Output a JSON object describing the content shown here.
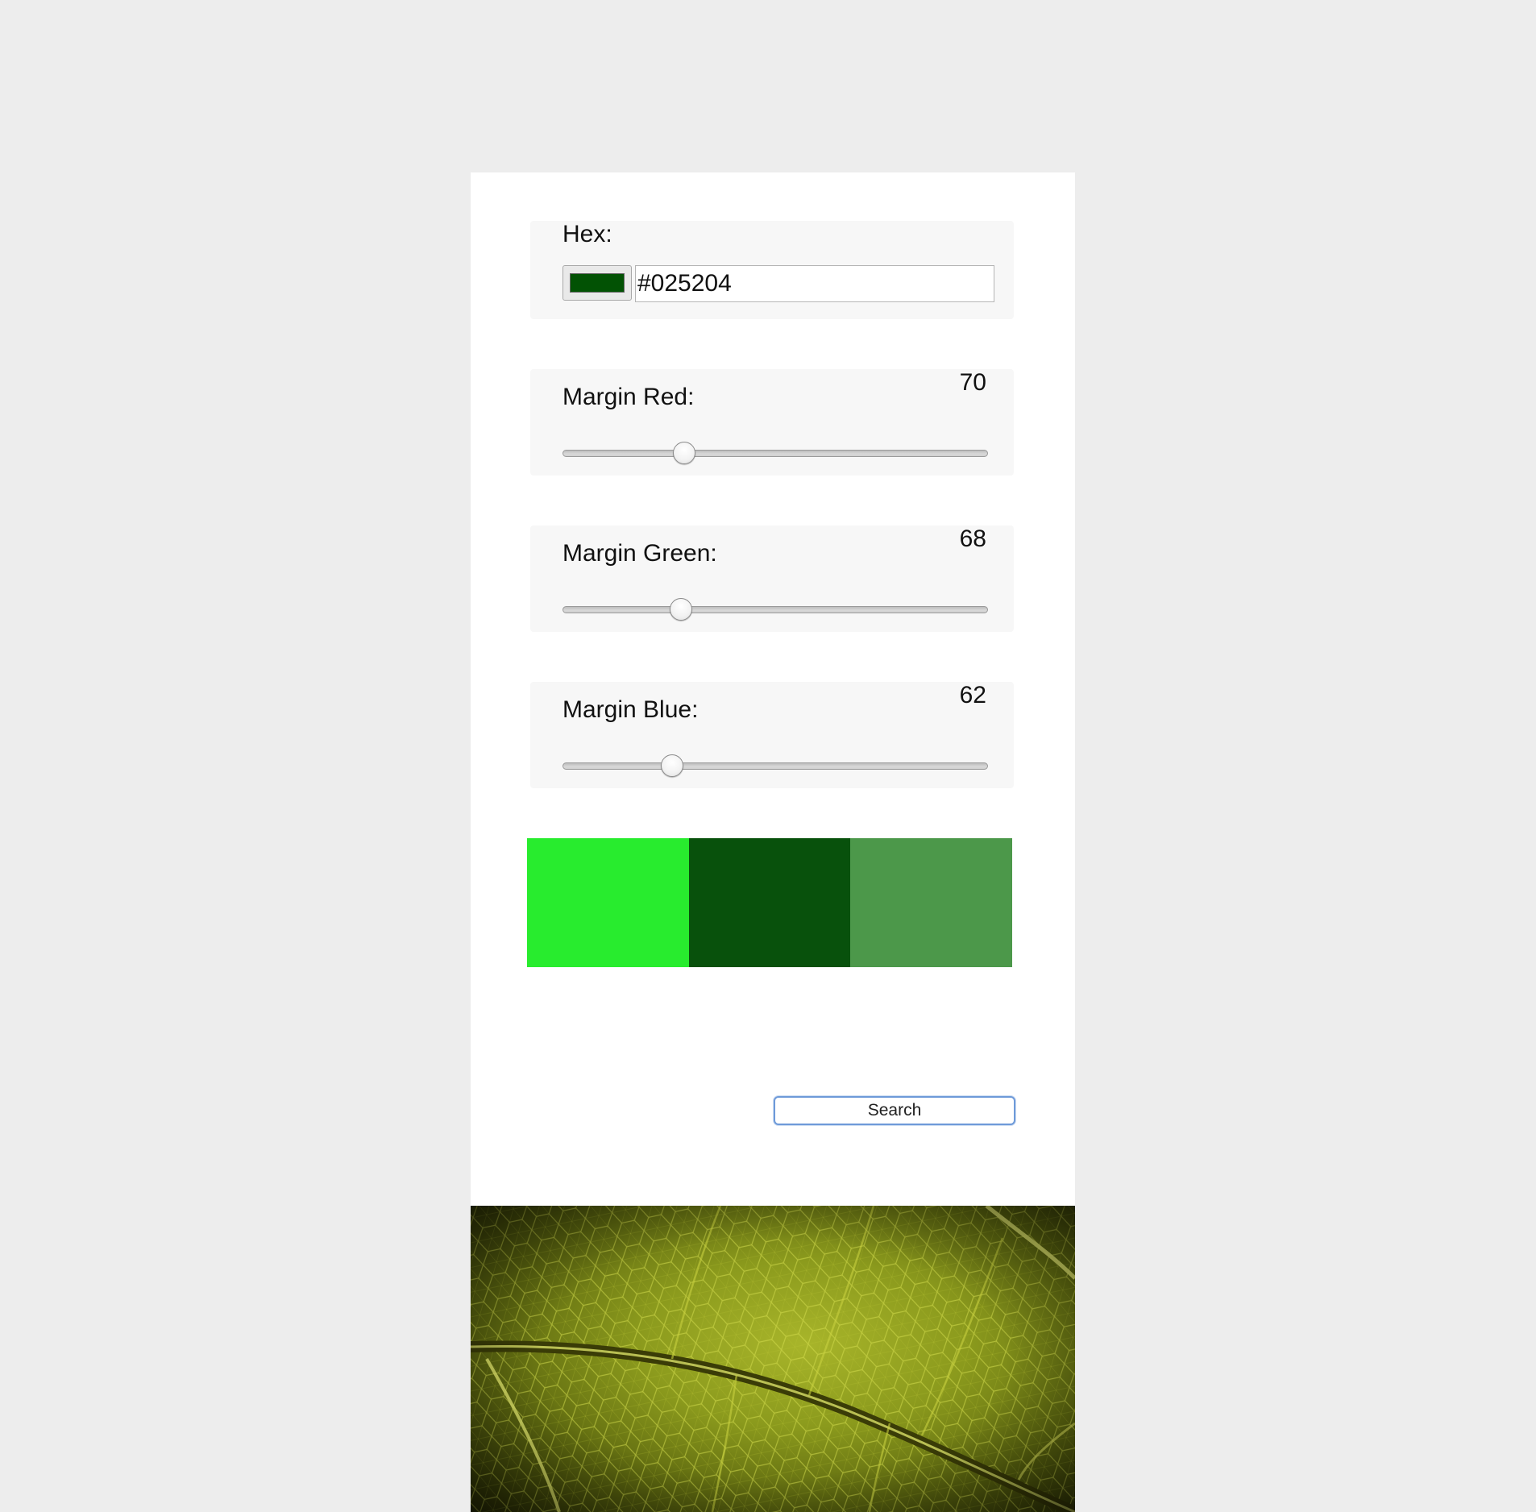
{
  "hex": {
    "label": "Hex:",
    "value": "#025204",
    "color": "#025204"
  },
  "sliders": {
    "red": {
      "label": "Margin Red:",
      "value": "70",
      "fraction": 0.286
    },
    "green": {
      "label": "Margin Green:",
      "value": "68",
      "fraction": 0.278
    },
    "blue": {
      "label": "Margin Blue:",
      "value": "62",
      "fraction": 0.258
    }
  },
  "swatches": {
    "colors": [
      "#28ec2e",
      "#08510c",
      "#4c984a"
    ]
  },
  "search_button": {
    "label": "Search"
  },
  "image": {
    "icon": "leaf-photo",
    "accent": "#8b9a1d"
  }
}
